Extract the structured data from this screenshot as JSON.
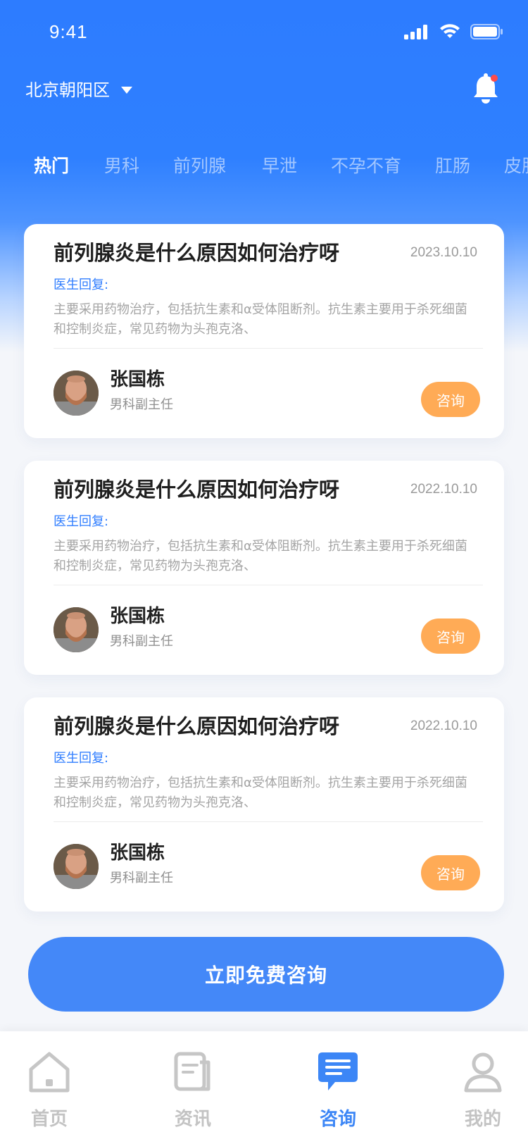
{
  "status_bar": {
    "time": "9:41"
  },
  "header": {
    "location": "北京朝阳区"
  },
  "category_tabs": [
    {
      "label": "热门",
      "active": true
    },
    {
      "label": "男科",
      "active": false
    },
    {
      "label": "前列腺",
      "active": false
    },
    {
      "label": "早泄",
      "active": false
    },
    {
      "label": "不孕不育",
      "active": false
    },
    {
      "label": "肛肠",
      "active": false
    },
    {
      "label": "皮肤",
      "active": false
    }
  ],
  "cards": [
    {
      "title": "前列腺炎是什么原因如何治疗呀",
      "date": "2023.10.10",
      "reply_label": "医生回复:",
      "reply_text": "主要采用药物治疗，包括抗生素和α受体阻断剂。抗生素主要用于杀死细菌和控制炎症，常见药物为头孢克洛、",
      "doctor_name": "张国栋",
      "doctor_title": "男科副主任",
      "consult_label": "咨询"
    },
    {
      "title": "前列腺炎是什么原因如何治疗呀",
      "date": "2022.10.10",
      "reply_label": "医生回复:",
      "reply_text": "主要采用药物治疗，包括抗生素和α受体阻断剂。抗生素主要用于杀死细菌和控制炎症，常见药物为头孢克洛、",
      "doctor_name": "张国栋",
      "doctor_title": "男科副主任",
      "consult_label": "咨询"
    },
    {
      "title": "前列腺炎是什么原因如何治疗呀",
      "date": "2022.10.10",
      "reply_label": "医生回复:",
      "reply_text": "主要采用药物治疗，包括抗生素和α受体阻断剂。抗生素主要用于杀死细菌和控制炎症，常见药物为头孢克洛、",
      "doctor_name": "张国栋",
      "doctor_title": "男科副主任",
      "consult_label": "咨询"
    }
  ],
  "cta": {
    "label": "立即免费咨询"
  },
  "tabbar": [
    {
      "label": "首页",
      "icon": "home-icon",
      "active": false
    },
    {
      "label": "资讯",
      "icon": "news-icon",
      "active": false
    },
    {
      "label": "咨询",
      "icon": "consult-chat-icon",
      "active": true
    },
    {
      "label": "我的",
      "icon": "profile-icon",
      "active": false
    }
  ],
  "colors": {
    "primary": "#2f80ff",
    "accent_orange": "#ffab56",
    "cta_blue": "#4488f8",
    "notification_dot": "#ff4b4b"
  }
}
